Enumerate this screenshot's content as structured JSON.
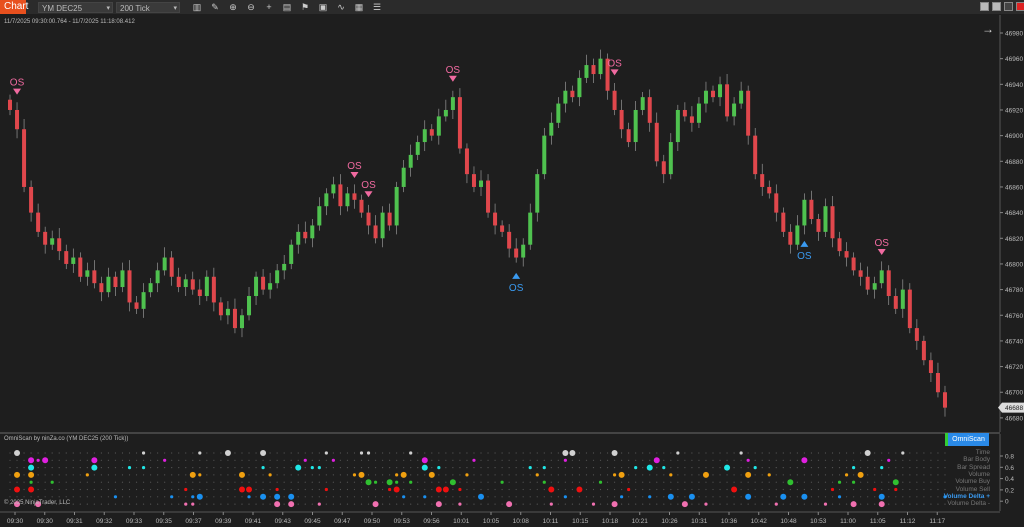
{
  "toolbar": {
    "app_tab": "Chart",
    "instrument": "YM DEC25",
    "interval": "200 Tick",
    "icons": [
      "bar-chart-icon",
      "pencil-icon",
      "zoom-in-icon",
      "zoom-out-icon",
      "crosshair-icon",
      "properties-icon",
      "flag-icon",
      "snapshot-icon",
      "strategy-icon",
      "calculator-icon",
      "list-icon"
    ]
  },
  "chart": {
    "range": "11/7/2025 09:30:00.764 - 11/7/2025 11:18:08.412",
    "price_ticks": [
      46980,
      46960,
      46940,
      46920,
      46900,
      46880,
      46860,
      46840,
      46820,
      46800,
      46780,
      46760,
      46740,
      46720,
      46700,
      46680
    ],
    "current_price": "46688",
    "up_color": "#4fc24f",
    "down_color": "#e0474c",
    "closes": [
      46920,
      46905,
      46860,
      46840,
      46825,
      46815,
      46820,
      46810,
      46800,
      46805,
      46790,
      46795,
      46785,
      46778,
      46790,
      46782,
      46795,
      46770,
      46765,
      46778,
      46785,
      46795,
      46805,
      46790,
      46782,
      46788,
      46780,
      46775,
      46790,
      46770,
      46760,
      46765,
      46750,
      46760,
      46775,
      46790,
      46780,
      46785,
      46795,
      46800,
      46815,
      46825,
      46820,
      46830,
      46845,
      46855,
      46862,
      46845,
      46855,
      46850,
      46840,
      46830,
      46820,
      46840,
      46830,
      46860,
      46875,
      46885,
      46895,
      46905,
      46900,
      46915,
      46920,
      46930,
      46890,
      46870,
      46860,
      46865,
      46840,
      46830,
      46825,
      46812,
      46805,
      46815,
      46840,
      46870,
      46900,
      46910,
      46925,
      46935,
      46930,
      46945,
      46955,
      46948,
      46960,
      46935,
      46920,
      46905,
      46895,
      46920,
      46930,
      46910,
      46880,
      46870,
      46895,
      46920,
      46915,
      46910,
      46925,
      46935,
      46930,
      46940,
      46915,
      46925,
      46935,
      46900,
      46870,
      46860,
      46855,
      46840,
      46825,
      46815,
      46830,
      46850,
      46835,
      46825,
      46845,
      46820,
      46810,
      46805,
      46795,
      46790,
      46780,
      46785,
      46795,
      46775,
      46765,
      46780,
      46750,
      46740,
      46725,
      46715,
      46700,
      46688
    ],
    "signals": [
      {
        "bar": 1,
        "type": "down",
        "label": "OS"
      },
      {
        "bar": 49,
        "type": "down",
        "label": "OS"
      },
      {
        "bar": 51,
        "type": "down",
        "label": "OS"
      },
      {
        "bar": 63,
        "type": "down",
        "label": "OS"
      },
      {
        "bar": 86,
        "type": "down",
        "label": "OS"
      },
      {
        "bar": 72,
        "type": "up",
        "label": "OS"
      },
      {
        "bar": 113,
        "type": "up",
        "label": "OS"
      },
      {
        "bar": 124,
        "type": "down",
        "label": "OS"
      }
    ],
    "signal_colors": {
      "down": "#f06aa0",
      "up": "#3a9af0"
    }
  },
  "indicator": {
    "title": "OmniScan by ninZa.co (YM DEC25 (200 Tick))",
    "button": "OmniScan",
    "copyright": "© 2025 NinjaTrader, LLC",
    "scale": [
      "0.8",
      "0.6",
      "0.4",
      "0.2",
      "0"
    ],
    "rows": [
      {
        "label": "Time",
        "color": "#d0d0d0",
        "big": [
          1,
          31,
          36,
          79,
          80,
          86,
          122
        ],
        "small": [
          19,
          27,
          45,
          50,
          51,
          57,
          95,
          104,
          127,
          140
        ]
      },
      {
        "label": "Bar Body",
        "color": "#e020e0",
        "big": [
          3,
          5,
          12,
          59,
          92,
          113
        ],
        "small": [
          4,
          22,
          42,
          46,
          66,
          79,
          105,
          125
        ]
      },
      {
        "label": "Bar Spread",
        "color": "#20e8e8",
        "big": [
          3,
          12,
          41,
          59,
          91,
          102
        ],
        "small": [
          17,
          19,
          36,
          44,
          43,
          61,
          74,
          76,
          89,
          93,
          106,
          120,
          124
        ]
      },
      {
        "label": "Volume",
        "color": "#f0a010",
        "big": [
          1,
          3,
          26,
          33,
          50,
          56,
          60,
          87,
          99,
          105,
          121
        ],
        "small": [
          11,
          27,
          37,
          49,
          55,
          65,
          75,
          86,
          94,
          108,
          119
        ]
      },
      {
        "label": "Volume Buy",
        "color": "#30c030",
        "big": [
          51,
          54,
          63,
          111,
          126
        ],
        "small": [
          3,
          6,
          52,
          55,
          57,
          70,
          76,
          84,
          118,
          120
        ]
      },
      {
        "label": "Volume Sell",
        "color": "#f01010",
        "big": [
          1,
          3,
          33,
          34,
          55,
          61,
          62,
          77,
          81,
          103
        ],
        "small": [
          25,
          38,
          45,
          54,
          64,
          88,
          117,
          123,
          126
        ]
      },
      {
        "label": "Volume Delta +",
        "color": "#1a90f0",
        "big": [
          27,
          36,
          38,
          40,
          67,
          94,
          97,
          105,
          110,
          113,
          124
        ],
        "small": [
          15,
          23,
          26,
          34,
          56,
          59,
          79,
          87,
          91,
          118,
          133
        ],
        "highlight": true
      },
      {
        "label": "Volume Delta -",
        "color": "#f070b0",
        "big": [
          1,
          4,
          38,
          40,
          52,
          61,
          71,
          86,
          96,
          120,
          124
        ],
        "small": [
          25,
          26,
          44,
          64,
          77,
          83,
          99,
          109,
          116
        ]
      }
    ]
  },
  "time_axis": [
    "09:30",
    "09:30",
    "09:31",
    "09:32",
    "09:33",
    "09:35",
    "09:37",
    "09:39",
    "09:41",
    "09:43",
    "09:45",
    "09:47",
    "09:50",
    "09:53",
    "09:56",
    "10:01",
    "10:05",
    "10:08",
    "10:11",
    "10:15",
    "10:18",
    "10:21",
    "10:26",
    "10:31",
    "10:36",
    "10:42",
    "10:48",
    "10:53",
    "11:00",
    "11:05",
    "11:12",
    "11:17"
  ]
}
